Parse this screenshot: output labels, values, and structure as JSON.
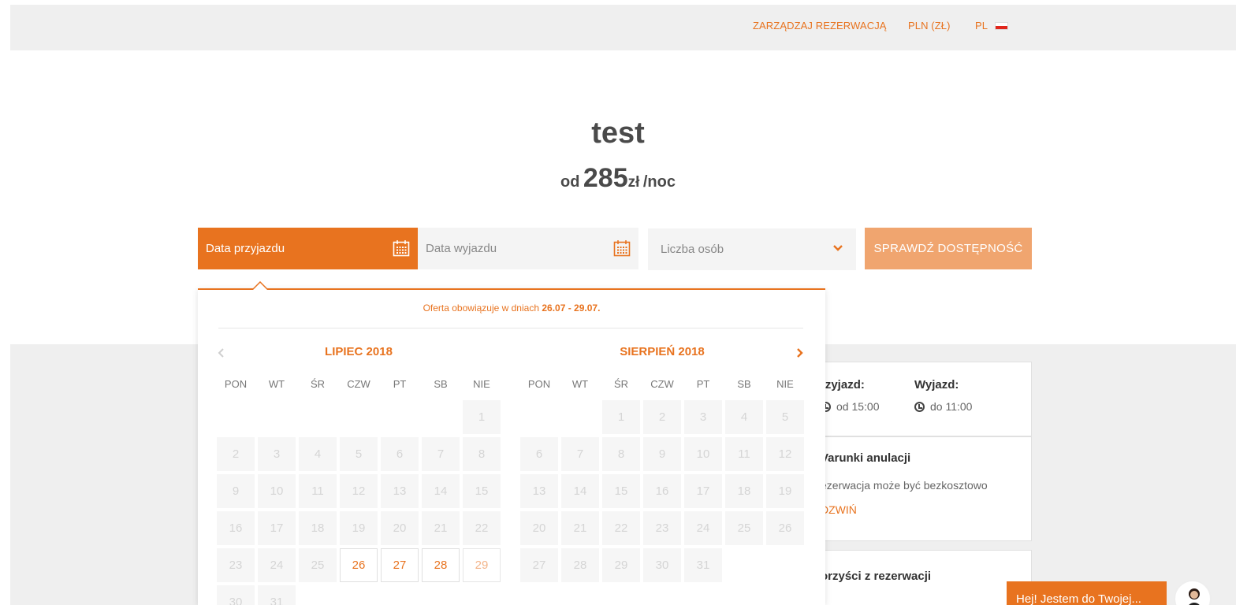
{
  "topnav": {
    "manage": "ZARZĄDZAJ REZERWACJĄ",
    "currency": "PLN (ZŁ)",
    "language": "PL"
  },
  "hero": {
    "title": "test",
    "price_prefix": "od",
    "price_value": "285",
    "price_currency": "zł",
    "price_suffix": "/noc"
  },
  "search": {
    "arrival_label": "Data przyjazdu",
    "departure_label": "Data wyjazdu",
    "guests_label": "Liczba osób",
    "check_button": "SPRAWDŹ DOSTĘPNOŚĆ"
  },
  "datepicker": {
    "offer_text": "Oferta obowiązuje w dniach",
    "offer_range": "26.07 - 29.07.",
    "weekdays": [
      "PON",
      "WT",
      "ŚR",
      "CZW",
      "PT",
      "SB",
      "NIE"
    ],
    "months": [
      {
        "title": "LIPIEC 2018",
        "cells": [
          "",
          "",
          "",
          "",
          "",
          "",
          "1",
          "2",
          "3",
          "4",
          "5",
          "6",
          "7",
          "8",
          "9",
          "10",
          "11",
          "12",
          "13",
          "14",
          "15",
          "16",
          "17",
          "18",
          "19",
          "20",
          "21",
          "22",
          "23",
          "24",
          "25",
          "26",
          "27",
          "28",
          "29",
          "30",
          "31"
        ],
        "available": [
          "26",
          "27",
          "28"
        ],
        "available_light": [
          "29"
        ]
      },
      {
        "title": "SIERPIEŃ 2018",
        "cells": [
          "",
          "",
          "1",
          "2",
          "3",
          "4",
          "5",
          "6",
          "7",
          "8",
          "9",
          "10",
          "11",
          "12",
          "13",
          "14",
          "15",
          "16",
          "17",
          "18",
          "19",
          "20",
          "21",
          "22",
          "23",
          "24",
          "25",
          "26",
          "27",
          "28",
          "29",
          "30",
          "31"
        ],
        "available": [],
        "available_light": []
      }
    ]
  },
  "info": {
    "arrival_heading": "rzyjazd:",
    "arrival_time": "od 15:00",
    "departure_heading": "Wyjazd:",
    "departure_time": "do 11:00",
    "cancel_heading": "Varunki anulacji",
    "cancel_text": "ezerwacja może być bezkosztowo",
    "expand_link": "DZWIŃ",
    "benefits_heading": "orzyści z rezerwacji"
  },
  "chat": {
    "text": "Hej! Jestem do Twojej..."
  },
  "colors": {
    "accent": "#e8731f",
    "accent_light": "#f0a56f",
    "band": "#efefef"
  }
}
